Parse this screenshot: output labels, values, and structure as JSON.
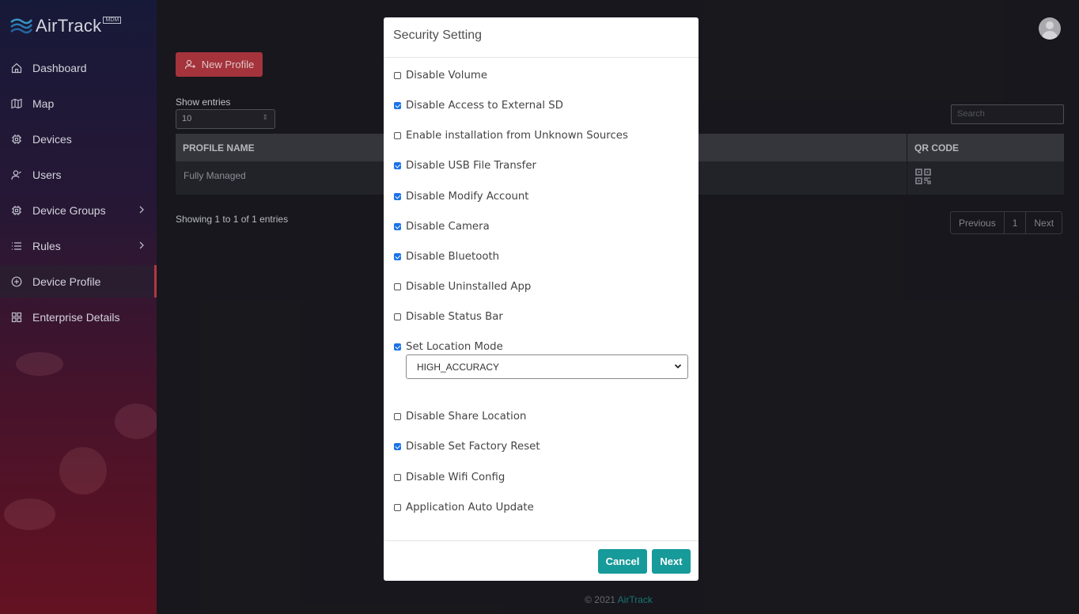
{
  "brand": {
    "name": "AirTrack",
    "tag": "MDM"
  },
  "sidebar": {
    "items": [
      {
        "label": "Dashboard",
        "icon": "home-icon"
      },
      {
        "label": "Map",
        "icon": "map-icon"
      },
      {
        "label": "Devices",
        "icon": "chip-icon"
      },
      {
        "label": "Users",
        "icon": "user-icon"
      },
      {
        "label": "Device Groups",
        "icon": "chip-icon"
      },
      {
        "label": "Rules",
        "icon": "list-icon"
      },
      {
        "label": "Device Profile",
        "icon": "plus-circle-icon"
      },
      {
        "label": "Enterprise Details",
        "icon": "grid-icon"
      }
    ]
  },
  "main": {
    "new_profile_label": "New Profile",
    "show_entries_label": "Show entries",
    "entries_value": "10",
    "search_placeholder": "Search",
    "table": {
      "headers": [
        "PROFILE NAME",
        "QR CODE"
      ],
      "rows": [
        {
          "profile_name": "Fully Managed"
        }
      ]
    },
    "showing_text": "Showing 1 to 1 of 1 entries",
    "pagination": {
      "previous": "Previous",
      "page": "1",
      "next": "Next"
    }
  },
  "footer": {
    "copyright": "© 2021",
    "link": "AirTrack"
  },
  "modal": {
    "title": "Security Setting",
    "options": [
      {
        "label": "Disable Volume",
        "checked": false
      },
      {
        "label": "Disable Access to External SD",
        "checked": true
      },
      {
        "label": "Enable installation from Unknown Sources",
        "checked": false
      },
      {
        "label": "Disable USB File Transfer",
        "checked": true
      },
      {
        "label": "Disable Modify Account",
        "checked": true
      },
      {
        "label": "Disable Camera",
        "checked": true
      },
      {
        "label": "Disable Bluetooth",
        "checked": true
      },
      {
        "label": "Disable Uninstalled App",
        "checked": false
      },
      {
        "label": "Disable Status Bar",
        "checked": false
      },
      {
        "label": "Set Location Mode",
        "checked": true
      },
      {
        "label": "Disable Share Location",
        "checked": false
      },
      {
        "label": "Disable Set Factory Reset",
        "checked": true
      },
      {
        "label": "Disable Wifi Config",
        "checked": false
      },
      {
        "label": "Application Auto Update",
        "checked": false
      }
    ],
    "location_mode_value": "HIGH_ACCURACY",
    "cancel_label": "Cancel",
    "next_label": "Next"
  },
  "colors": {
    "accent_red": "#b33840",
    "teal": "#179a9a",
    "checkbox_blue": "#1a73e8"
  }
}
